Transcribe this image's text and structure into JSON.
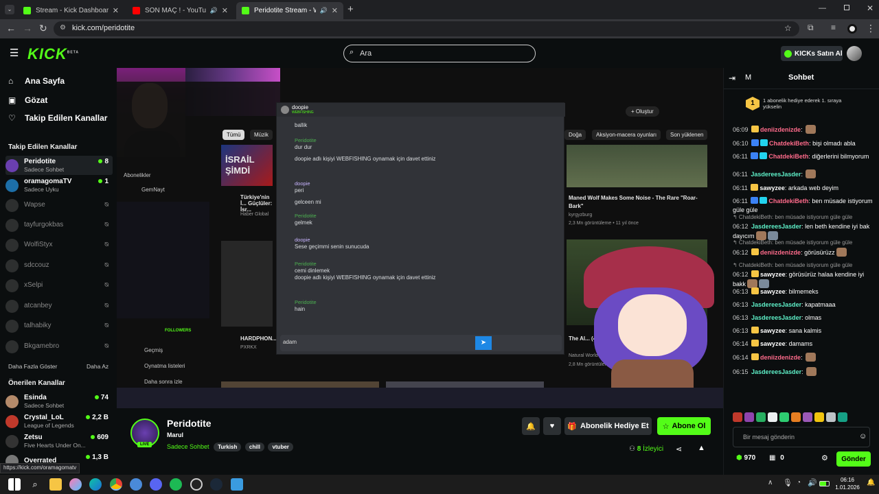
{
  "browser": {
    "tabs": [
      {
        "title": "Stream - Kick Dashboard",
        "active": false
      },
      {
        "title": "SON MAÇ ! - YouTube",
        "active": false
      },
      {
        "title": "Peridotite Stream - Watch L",
        "active": true
      }
    ],
    "url": "kick.com/peridotite",
    "status_url": "https://kick.com/oramagomatv"
  },
  "header": {
    "logo": "KICK",
    "logo_badge": "BETA",
    "search_placeholder": "Ara",
    "kicks_button": "KICKs Satın Al"
  },
  "sidebar": {
    "nav": [
      {
        "label": "Ana Sayfa",
        "icon": "home-icon"
      },
      {
        "label": "Gözat",
        "icon": "browse-icon"
      },
      {
        "label": "Takip Edilen Kanallar",
        "icon": "heart-icon"
      }
    ],
    "followed_title": "Takip Edilen Kanallar",
    "followed": [
      {
        "name": "Peridotite",
        "sub": "Sadece Sohbet",
        "count": "8",
        "live": true
      },
      {
        "name": "oramagomaTV",
        "sub": "Sadece Uyku",
        "count": "1",
        "live": true
      },
      {
        "name": "Wapse",
        "live": false
      },
      {
        "name": "tayfurgokbas",
        "live": false
      },
      {
        "name": "WolfiStyx",
        "live": false
      },
      {
        "name": "sdccouz",
        "live": false
      },
      {
        "name": "xSelpi",
        "live": false
      },
      {
        "name": "atcanbey",
        "live": false
      },
      {
        "name": "talhabiky",
        "live": false
      },
      {
        "name": "Bkgamebro",
        "live": false
      }
    ],
    "show_more": "Daha Fazla Göster",
    "show_less": "Daha Az",
    "recommended_title": "Önerilen Kanallar",
    "recommended": [
      {
        "name": "Esinda",
        "sub": "Sadece Sohbet",
        "count": "74"
      },
      {
        "name": "Crystal_LoL",
        "sub": "League of Legends",
        "count": "2,2 B"
      },
      {
        "name": "Zetsu",
        "sub": "Five Hearts Under On...",
        "count": "609"
      },
      {
        "name": "Overrated",
        "sub": "",
        "count": "1,3 B"
      }
    ]
  },
  "video": {
    "yt_chips": [
      "Tümü",
      "Müzik",
      "Doğa",
      "Aksiyon-macera oyunları",
      "Son yüklenen"
    ],
    "yt_create": "Oluştur",
    "yt_menu": [
      "Abonelikler",
      "GemNayt",
      "Geçmiş",
      "Oynatma listeleri",
      "Daha sonra izle"
    ],
    "yt_video1_title": "Maned Wolf Makes Some Noise - The Rare \"Roar-Bark\"",
    "yt_video1_channel": "kyrgyzburg",
    "yt_video1_meta": "2,3 Mn görüntüleme • 11 yıl önce",
    "yt_video2_title": "Türkiye'nin İ... Güçlüler: İsr...",
    "yt_video2_channel": "Haber Global",
    "yt_video3_title": "HARDPHON...",
    "yt_video3_channel": "PXRKX",
    "yt_video4_title": "The Al... (4K)",
    "yt_video4_channel": "Natural World F...",
    "yt_video4_meta": "2,8 Mn görüntülen...",
    "yt_thumb_text": "İSRAİL ŞİMDİ",
    "dc_user": "doopie",
    "dc_status": "WEBFISHING",
    "dc_messages": [
      {
        "author": "",
        "text": "ballik"
      },
      {
        "author": "Peridotite",
        "text": "dur dur"
      },
      {
        "author": "",
        "text": "doopie adlı kişiyi WEBFISHING oynamak için davet ettiniz"
      },
      {
        "author": "doopie",
        "text": "peri"
      },
      {
        "author": "",
        "text": "gelceen mi"
      },
      {
        "author": "Peridotite",
        "text": "gelmek"
      },
      {
        "author": "doopie",
        "text": "Sese geçimmi senin sunucuda"
      },
      {
        "author": "Peridotite",
        "text": "cemi dinlemek"
      },
      {
        "author": "",
        "text": "doopie adlı kişiyi WEBFISHING oynamak için davet ettiniz"
      },
      {
        "author": "Peridotite",
        "text": "hain"
      }
    ],
    "dc_input": "adam",
    "overlay_follow": "FOLLOWERS"
  },
  "stream": {
    "name": "Peridotite",
    "title": "Marul",
    "live_label": "LIVE",
    "category": "Sadece Sohbet",
    "tags": [
      "Turkish",
      "chill",
      "vtuber"
    ],
    "gift_button": "Abonelik Hediye Et",
    "subscribe_button": "Abone Ol",
    "viewers": "8",
    "viewers_label": "İzleyici"
  },
  "chat": {
    "title": "Sohbet",
    "mode_label": "M",
    "pinned_rank": "1",
    "pinned_text": "1 abonelik hediye ederek 1. sıraya yükselin",
    "messages": [
      {
        "kind": "msg",
        "time": "06:09",
        "user": "deniizdenizde",
        "color": "#ff6b8b",
        "badges": [
          "crown"
        ],
        "text": "",
        "emotes": 1
      },
      {
        "kind": "msg",
        "time": "06:10",
        "user": "ChatdekiBeth",
        "color": "#ff6b8b",
        "badges": [
          "blue",
          "cyan"
        ],
        "text": "bişi olmadı abla",
        "emotes": 0
      },
      {
        "kind": "msg",
        "time": "06:11",
        "user": "ChatdekiBeth",
        "color": "#ff6b8b",
        "badges": [
          "blue",
          "cyan"
        ],
        "text": "diğerlerini bilmyorum",
        "emotes": 0
      },
      {
        "kind": "msg",
        "time": "06:11",
        "user": "JasdereesJasder",
        "color": "#5ef0c8",
        "badges": [],
        "text": "",
        "emotes": 1
      },
      {
        "kind": "msg",
        "time": "06:11",
        "user": "sawyzee",
        "color": "#ffffff",
        "badges": [
          "crown"
        ],
        "text": "arkada web deyim",
        "emotes": 0
      },
      {
        "kind": "msg",
        "time": "06:11",
        "user": "ChatdekiBeth",
        "color": "#ff6b8b",
        "badges": [
          "blue",
          "cyan"
        ],
        "text": "ben müsade istiyorum güle güle",
        "emotes": 0
      },
      {
        "kind": "reply",
        "text": "ChatdekiBeth: ben müsade istiyorum güle güle"
      },
      {
        "kind": "msg",
        "time": "06:12",
        "user": "JasdereesJasder",
        "color": "#5ef0c8",
        "badges": [],
        "text": "len beth kendine iyi bak dayıcım",
        "emotes": 2
      },
      {
        "kind": "reply",
        "text": "ChatdekiBeth: ben müsade istiyorum güle güle"
      },
      {
        "kind": "msg",
        "time": "06:12",
        "user": "deniizdenizde",
        "color": "#ff6b8b",
        "badges": [
          "crown"
        ],
        "text": "görüsürüzz",
        "emotes": 1
      },
      {
        "kind": "reply",
        "text": "ChatdekiBeth: ben müsade istiyorum güle güle"
      },
      {
        "kind": "msg",
        "time": "06:12",
        "user": "sawyzee",
        "color": "#ffffff",
        "badges": [
          "crown"
        ],
        "text": "görüsürüz halaa kendine iyi bakk",
        "emotes": 2
      },
      {
        "kind": "msg",
        "time": "06:13",
        "user": "sawyzee",
        "color": "#ffffff",
        "badges": [
          "crown"
        ],
        "text": "bilmemeks",
        "emotes": 0
      },
      {
        "kind": "msg",
        "time": "06:13",
        "user": "JasdereesJasder",
        "color": "#5ef0c8",
        "badges": [],
        "text": "kapatmaaa",
        "emotes": 0
      },
      {
        "kind": "msg",
        "time": "06:13",
        "user": "JasdereesJasder",
        "color": "#5ef0c8",
        "badges": [],
        "text": "olmas",
        "emotes": 0
      },
      {
        "kind": "msg",
        "time": "06:13",
        "user": "sawyzee",
        "color": "#ffffff",
        "badges": [
          "crown"
        ],
        "text": "sana kalmis",
        "emotes": 0
      },
      {
        "kind": "msg",
        "time": "06:14",
        "user": "sawyzee",
        "color": "#ffffff",
        "badges": [
          "crown"
        ],
        "text": "damams",
        "emotes": 0
      },
      {
        "kind": "msg",
        "time": "06:14",
        "user": "deniizdenizde",
        "color": "#ff6b8b",
        "badges": [
          "crown"
        ],
        "text": "",
        "emotes": 1
      },
      {
        "kind": "msg",
        "time": "06:15",
        "user": "JasdereesJasder",
        "color": "#5ef0c8",
        "badges": [],
        "text": "",
        "emotes": 1
      }
    ],
    "input_placeholder": "Bir mesaj gönderin",
    "points": "970",
    "gifts": "0",
    "send_button": "Gönder"
  },
  "taskbar": {
    "time": "06:16",
    "date": "1.01.2026"
  },
  "colors": {
    "kick_green": "#53fc18",
    "background": "#0b0e0f",
    "panel": "#2c3033"
  }
}
